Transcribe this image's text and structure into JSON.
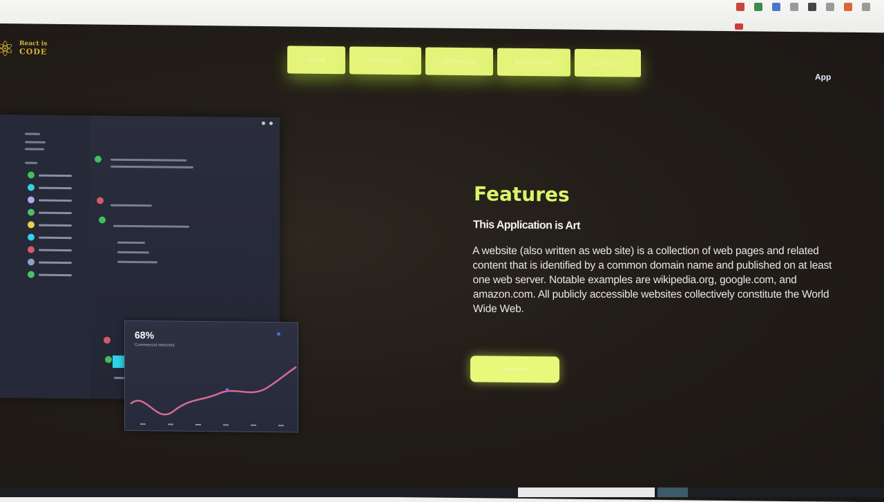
{
  "header": {
    "logo_line1": "React is",
    "logo_line2": "CODE",
    "nav": [
      {
        "label": "Home"
      },
      {
        "label": "Features"
      },
      {
        "label": "Services"
      },
      {
        "label": "Subscribe"
      },
      {
        "label": "Contact"
      }
    ],
    "app_label": "App"
  },
  "preview": {
    "sidebar_dots": [
      "#3fbf5a",
      "#2fd3e8",
      "#b7a6e8",
      "#49c16a",
      "#e6d24a",
      "#2fd3e8",
      "#d35a6a",
      "#8aa0c8",
      "#49c16a"
    ],
    "card_percent": "68%",
    "card_subtitle": "Commercial networks"
  },
  "features": {
    "title": "Features",
    "subtitle": "This Application is Art",
    "body": "A website (also written as web site) is a collection of web pages and related content that is identified by a common domain name and published on at least one web server. Notable examples are wikipedia.org, google.com, and amazon.com. All publicly accessible websites collectively constitute the World Wide Web.",
    "cta": "Learn More"
  },
  "colors": {
    "accent": "#d9f56a",
    "button": "#e4f47a",
    "background": "#221d18"
  }
}
